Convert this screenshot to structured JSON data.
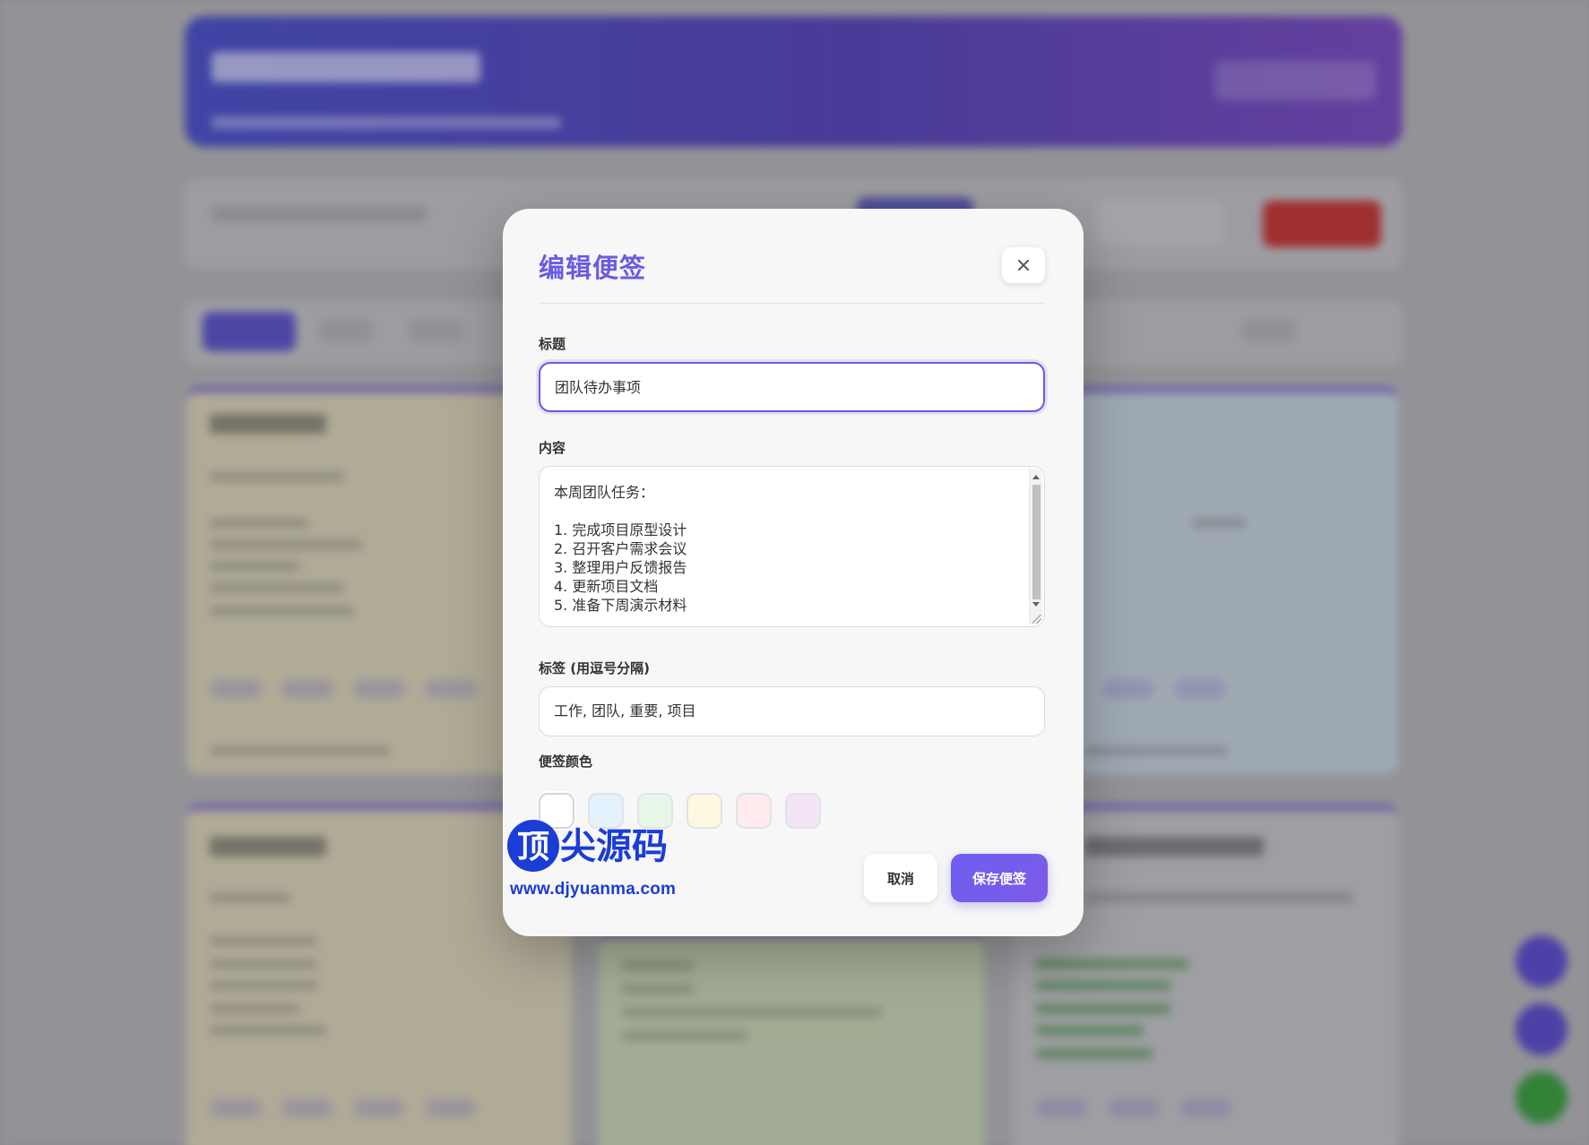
{
  "modal": {
    "title": "编辑便签",
    "close_icon": "close-icon",
    "title_label": "标题",
    "title_value": "团队待办事项",
    "content_label": "内容",
    "content_lines": [
      "本周团队任务：",
      "",
      "1. 完成项目原型设计",
      "2. 召开客户需求会议",
      "3. 整理用户反馈报告",
      "4. 更新项目文档",
      "5. 准备下周演示材料"
    ],
    "tags_label": "标签 (用逗号分隔)",
    "tags_value": "工作, 团队, 重要, 项目",
    "color_label": "便签颜色",
    "colors": [
      "#ffffff",
      "#e3f2fd",
      "#e8f5e9",
      "#fff8e1",
      "#ffebee",
      "#f3e5f5"
    ],
    "selected_color": "#ffffff",
    "cancel_label": "取消",
    "save_label": "保存便签"
  },
  "watermark": {
    "brand": "顶尖源码",
    "url": "www.djyuanma.com"
  }
}
